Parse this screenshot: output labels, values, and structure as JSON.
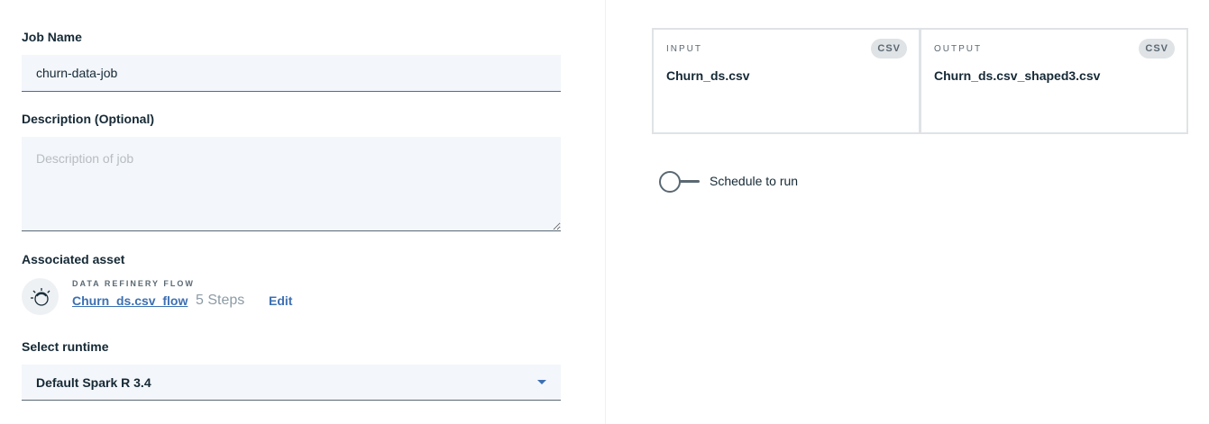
{
  "job": {
    "name_label": "Job Name",
    "name_value": "churn-data-job",
    "description_label": "Description (Optional)",
    "description_placeholder": "Description of job",
    "description_value": ""
  },
  "asset": {
    "label": "Associated asset",
    "type": "DATA REFINERY FLOW",
    "name": "Churn_ds.csv_flow",
    "steps": "5 Steps",
    "edit_label": "Edit",
    "icon": "refinery-flow-icon"
  },
  "runtime": {
    "label": "Select runtime",
    "selected": "Default Spark R 3.4"
  },
  "input": {
    "kicker": "INPUT",
    "badge": "CSV",
    "file": "Churn_ds.csv"
  },
  "output": {
    "kicker": "OUTPUT",
    "badge": "CSV",
    "file": "Churn_ds.csv_shaped3.csv"
  },
  "schedule": {
    "label": "Schedule to run",
    "enabled": false
  },
  "colors": {
    "accent": "#3d70b2",
    "field_bg": "#f3f6fa",
    "text": "#152935",
    "muted": "#5a6872"
  }
}
